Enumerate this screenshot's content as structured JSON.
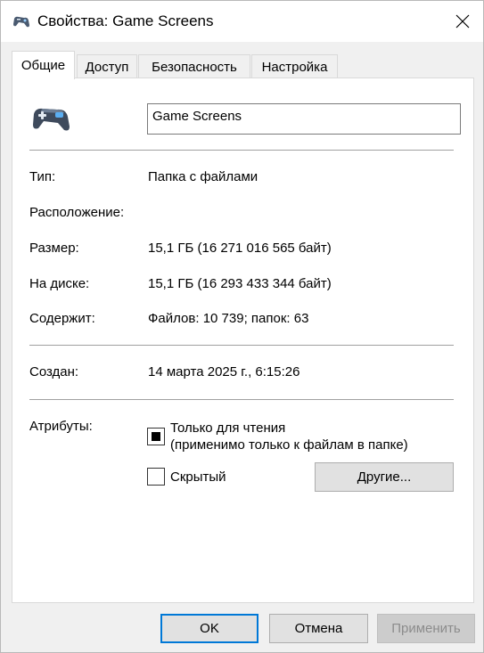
{
  "window": {
    "title": "Свойства: Game Screens",
    "title_icon": "gamepad-icon",
    "close_icon": "close-icon"
  },
  "tabs": [
    {
      "label": "Общие",
      "active": true
    },
    {
      "label": "Доступ",
      "active": false
    },
    {
      "label": "Безопасность",
      "active": false
    },
    {
      "label": "Настройка",
      "active": false
    }
  ],
  "general": {
    "folder_icon": "gamepad-icon",
    "name": "Game Screens",
    "type_label": "Тип:",
    "type_value": "Папка с файлами",
    "location_label": "Расположение:",
    "location_value": "",
    "size_label": "Размер:",
    "size_value": "15,1 ГБ (16 271 016 565 байт)",
    "disk_label": "На диске:",
    "disk_value": "15,1 ГБ (16 293 433 344 байт)",
    "contains_label": "Содержит:",
    "contains_value": "Файлов: 10 739; папок: 63",
    "created_label": "Создан:",
    "created_value": "14 марта 2025 г., 6:15:26",
    "attributes_label": "Атрибуты:",
    "readonly_line1": "Только для чтения",
    "readonly_line2": "(применимо только к файлам в папке)",
    "readonly_state": "indeterminate",
    "hidden_label": "Скрытый",
    "hidden_checked": false,
    "advanced_button": "Другие..."
  },
  "buttons": {
    "ok": "OK",
    "cancel": "Отмена",
    "apply": "Применить"
  },
  "colors": {
    "accent": "#0078d7",
    "window_bg": "#f0f0f0",
    "panel_bg": "#ffffff"
  }
}
